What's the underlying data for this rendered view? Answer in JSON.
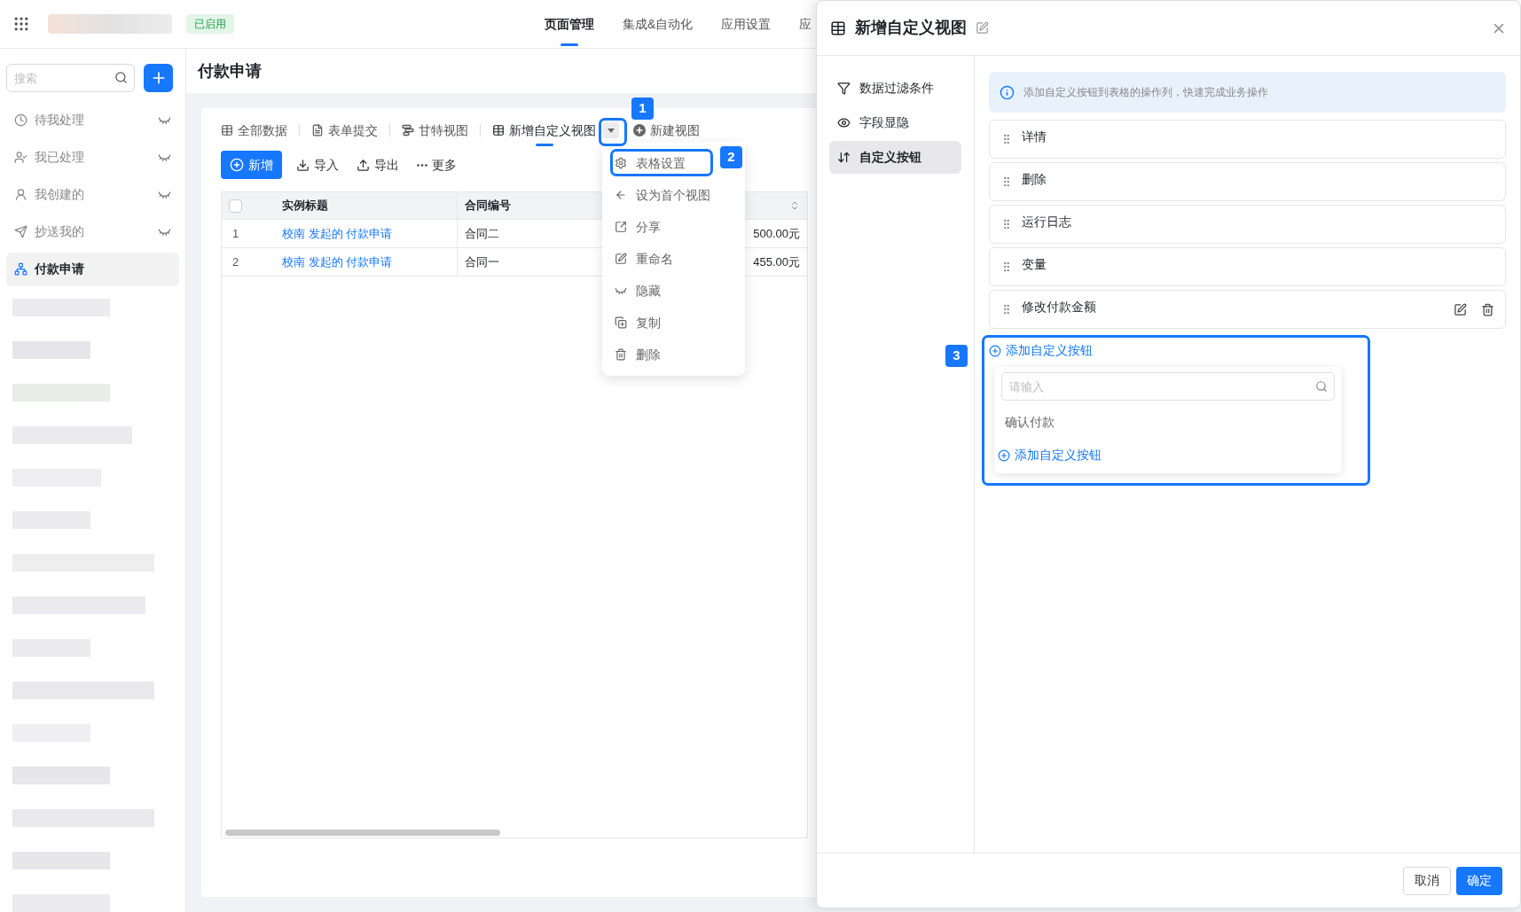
{
  "top_bar": {
    "status_badge": "已启用",
    "nav_tabs": [
      {
        "label": "页面管理",
        "selected": true
      },
      {
        "label": "集成&自动化",
        "selected": false
      },
      {
        "label": "应用设置",
        "selected": false
      },
      {
        "label": "应",
        "selected": false
      }
    ]
  },
  "sidebar": {
    "search": {
      "placeholder": "搜索"
    },
    "items": [
      {
        "label": "待我处理",
        "hidden": true,
        "selected": false
      },
      {
        "label": "我已处理",
        "hidden": true,
        "selected": false
      },
      {
        "label": "我创建的",
        "hidden": true,
        "selected": false
      },
      {
        "label": "抄送我的",
        "hidden": true,
        "selected": false
      },
      {
        "label": "付款申请",
        "hidden": false,
        "selected": true
      }
    ]
  },
  "page": {
    "title": "付款申请",
    "view_tabs": [
      {
        "label": "全部数据",
        "selected": false
      },
      {
        "label": "表单提交",
        "selected": false
      },
      {
        "label": "甘特视图",
        "selected": false
      },
      {
        "label": "新增自定义视图",
        "selected": true
      }
    ],
    "new_view": "新建视图",
    "toolbar": [
      {
        "label": "新增",
        "kind": "primary"
      },
      {
        "label": "导入",
        "kind": "plain"
      },
      {
        "label": "导出",
        "kind": "plain"
      },
      {
        "label": "更多",
        "kind": "plain"
      }
    ],
    "table": {
      "select_all_checked": false,
      "columns": [
        "实例标题",
        "合同编号"
      ],
      "rows": [
        {
          "index": "1",
          "title": "校南 发起的 付款申请",
          "contract": "合同二",
          "amount": "500.00元"
        },
        {
          "index": "2",
          "title": "校南 发起的 付款申请",
          "contract": "合同一",
          "amount": "455.00元"
        }
      ]
    }
  },
  "view_menu": {
    "items": [
      "表格设置",
      "设为首个视图",
      "分享",
      "重命名",
      "隐藏",
      "复制",
      "删除"
    ]
  },
  "drawer": {
    "title": "新增自定义视图",
    "nav": [
      {
        "label": "数据过滤条件",
        "selected": false
      },
      {
        "label": "字段显隐",
        "selected": false
      },
      {
        "label": "自定义按钮",
        "selected": true
      }
    ],
    "info": "添加自定义按钮到表格的操作列，快速完成业务操作",
    "buttons": [
      {
        "label": "详情",
        "hovered": false
      },
      {
        "label": "删除",
        "hovered": false
      },
      {
        "label": "运行日志",
        "hovered": false
      },
      {
        "label": "变量",
        "hovered": false
      },
      {
        "label": "修改付款金额",
        "hovered": true
      }
    ],
    "add_link": "添加自定义按钮",
    "picker": {
      "placeholder": "请输入",
      "options": [
        "确认付款"
      ],
      "add_link": "添加自定义按钮"
    },
    "footer": [
      {
        "label": "取消",
        "kind": "plain"
      },
      {
        "label": "确定",
        "kind": "primary"
      }
    ]
  },
  "annotations": [
    {
      "label": "1"
    },
    {
      "label": "2"
    },
    {
      "label": "3"
    }
  ]
}
